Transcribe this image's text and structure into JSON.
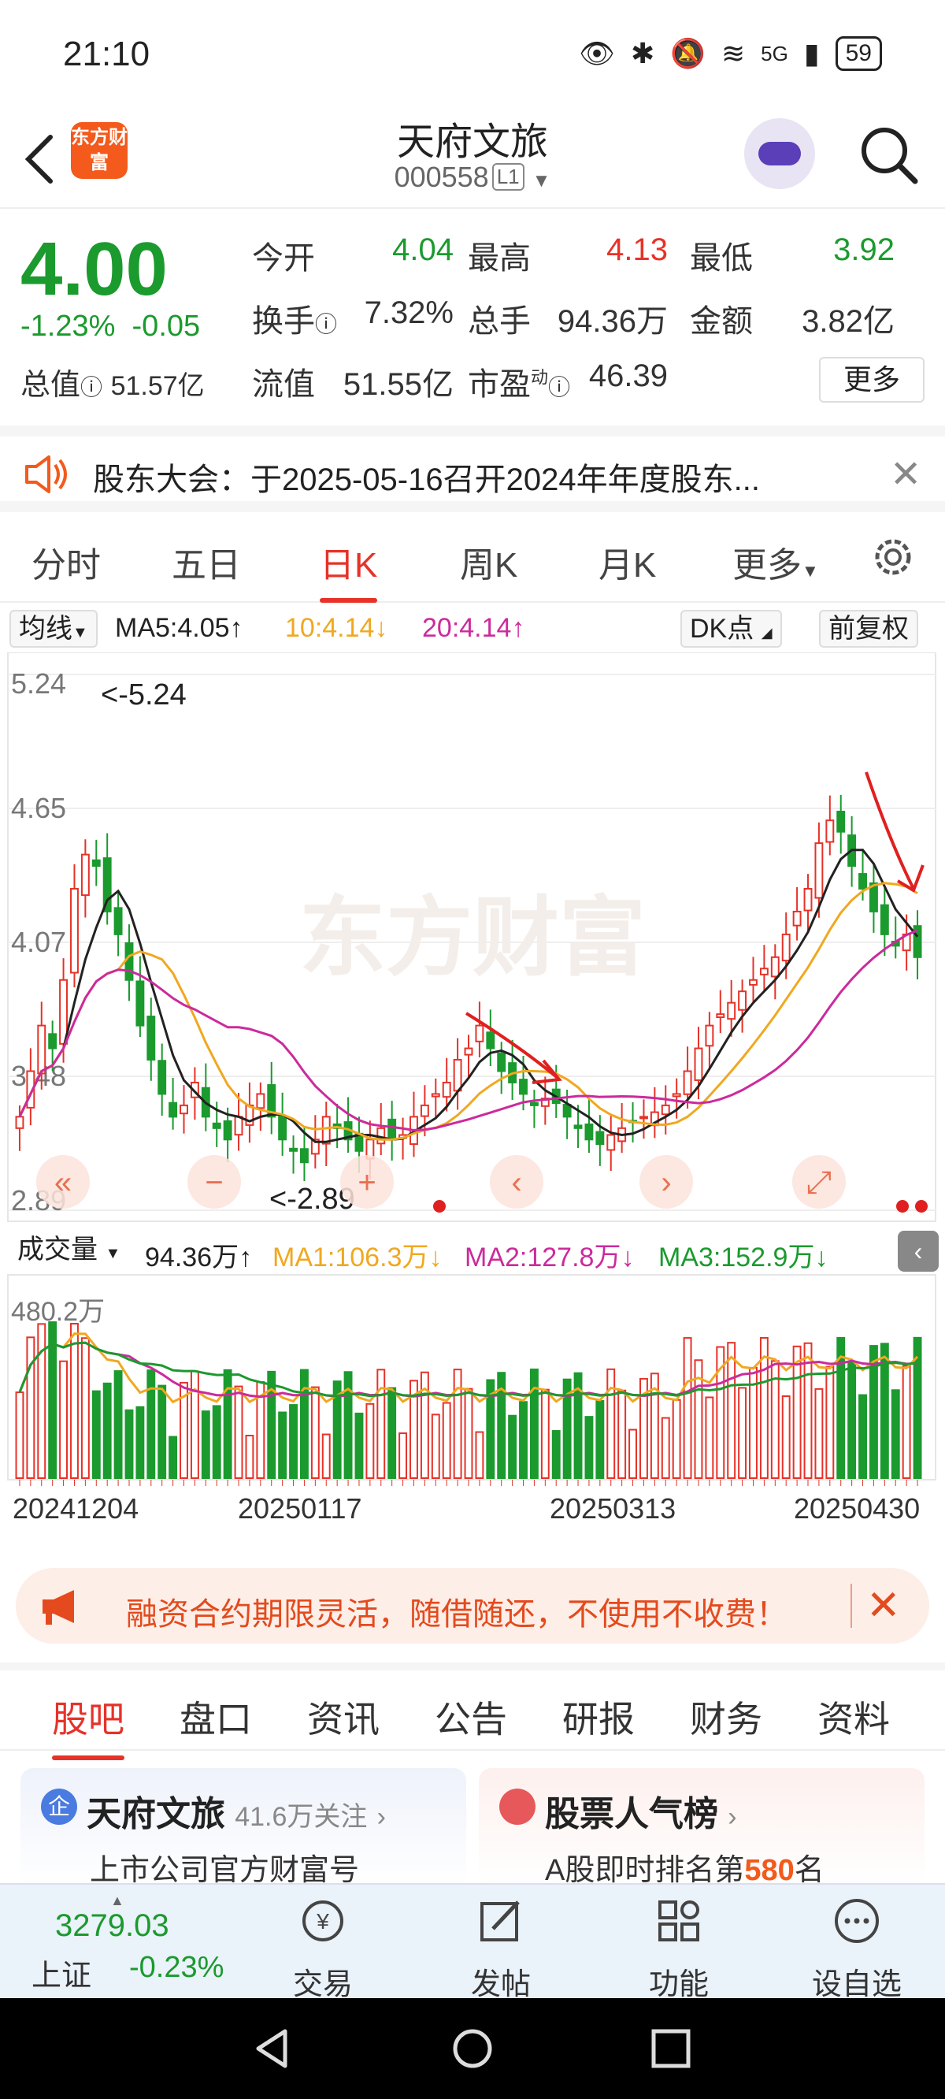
{
  "status": {
    "time": "21:10",
    "battery": "59",
    "network": "5G"
  },
  "header": {
    "stock_name": "天府文旅",
    "stock_code": "000558",
    "level_tag": "L1",
    "logo_text": "东方财富"
  },
  "quote": {
    "price": "4.00",
    "change_pct": "-1.23%",
    "change_abs": "-0.05",
    "total_value_label": "总值",
    "total_value": "51.57亿",
    "row1": [
      {
        "label": "今开",
        "value": "4.04",
        "color": "#1b9a2e"
      },
      {
        "label": "最高",
        "value": "4.13",
        "color": "#e63228"
      },
      {
        "label": "最低",
        "value": "3.92",
        "color": "#1b9a2e"
      }
    ],
    "row2": [
      {
        "label": "换手",
        "value": "7.32%"
      },
      {
        "label": "总手",
        "value": "94.36万"
      },
      {
        "label": "金额",
        "value": "3.82亿"
      }
    ],
    "row3": [
      {
        "label": "流值",
        "value": "51.55亿"
      },
      {
        "label": "市盈",
        "value": "46.39",
        "sup": "动"
      }
    ],
    "more_label": "更多"
  },
  "notice": {
    "text": "股东大会：于2025-05-16召开2024年年度股东..."
  },
  "kline_tabs": [
    "分时",
    "五日",
    "日K",
    "周K",
    "月K",
    "更多"
  ],
  "active_kline_tab": "日K",
  "ma_row": {
    "selector": "均线",
    "ma5": "MA5:4.05↑",
    "ma10": "10:4.14↓",
    "ma20": "20:4.14↑",
    "dk_label": "DK点",
    "fq_label": "前复权",
    "colors": {
      "ma5": "#222222",
      "ma10": "#f0a820",
      "ma20": "#cc2a9c"
    }
  },
  "price_axis": [
    "5.24",
    "4.65",
    "4.07",
    "3.48",
    "2.89"
  ],
  "annotations": {
    "high": "<-5.24",
    "low": "<-2.89"
  },
  "volume_row": {
    "selector": "成交量",
    "vol": "94.36万↑",
    "ma1": "MA1:106.3万↓",
    "ma2": "MA2:127.8万↓",
    "ma3": "MA3:152.9万↓",
    "axis_max": "480.2万"
  },
  "dates": [
    "20241204",
    "20250117",
    "20250313",
    "20250430"
  ],
  "banner": {
    "text": "融资合约期限灵活，随借随还，不使用不收费！"
  },
  "bottom_tabs": [
    "股吧",
    "盘口",
    "资讯",
    "公告",
    "研报",
    "财务",
    "资料"
  ],
  "active_bottom_tab": "股吧",
  "cards": {
    "left": {
      "title": "天府文旅",
      "follow": "41.6万关注",
      "sub": "上市公司官方财富号"
    },
    "right": {
      "title": "股票人气榜",
      "sub_prefix": "A股即时排名第",
      "rank": "580",
      "sub_suffix": "名"
    }
  },
  "index": {
    "value": "3279.03",
    "name": "上证",
    "change": "-0.23%"
  },
  "bottom_nav": [
    {
      "label": "交易",
      "icon": "yen-exchange-icon"
    },
    {
      "label": "发帖",
      "icon": "edit-icon"
    },
    {
      "label": "功能",
      "icon": "grid-icon"
    },
    {
      "label": "设自选",
      "icon": "more-dots-icon"
    }
  ],
  "chart_data": {
    "type": "candlestick",
    "price_range": [
      2.89,
      5.24
    ],
    "x_labels": [
      "20241204",
      "20250117",
      "20250313",
      "20250430"
    ],
    "closes_approx": [
      3.3,
      3.5,
      3.7,
      3.6,
      3.9,
      4.3,
      4.45,
      4.4,
      4.2,
      4.1,
      3.9,
      3.7,
      3.55,
      3.4,
      3.3,
      3.35,
      3.45,
      3.3,
      3.25,
      3.2,
      3.3,
      3.35,
      3.4,
      3.3,
      3.2,
      3.15,
      3.1,
      3.2,
      3.3,
      3.25,
      3.2,
      3.15,
      3.2,
      3.25,
      3.2,
      3.22,
      3.3,
      3.35,
      3.4,
      3.45,
      3.55,
      3.6,
      3.7,
      3.6,
      3.5,
      3.45,
      3.4,
      3.35,
      3.38,
      3.36,
      3.3,
      3.25,
      3.2,
      3.18,
      3.22,
      3.25,
      3.28,
      3.3,
      3.32,
      3.35,
      3.4,
      3.5,
      3.6,
      3.7,
      3.75,
      3.8,
      3.85,
      3.9,
      3.95,
      4.0,
      4.1,
      4.2,
      4.3,
      4.5,
      4.6,
      4.55,
      4.4,
      4.3,
      4.2,
      4.1,
      4.05,
      4.1,
      4.0
    ]
  }
}
